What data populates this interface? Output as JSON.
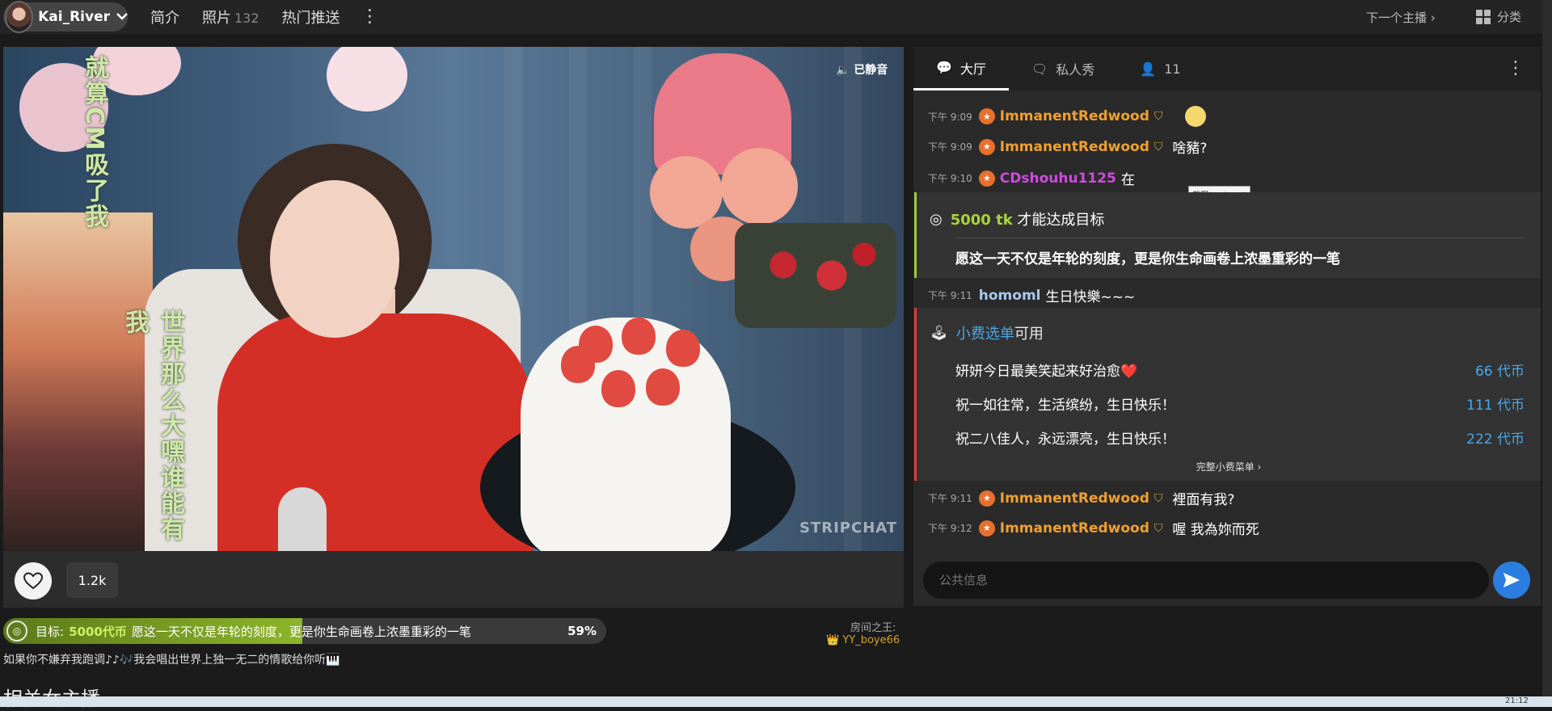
{
  "header": {
    "username": "Kai_River",
    "nav": [
      {
        "label": "简介",
        "count": ""
      },
      {
        "label": "照片",
        "count": "132"
      },
      {
        "label": "热门推送",
        "count": ""
      }
    ],
    "next_streamer": "下一个主播",
    "category": "分类"
  },
  "video": {
    "muted_label": "已静音",
    "overlay_text_1": "就算CM吸了我",
    "overlay_text_2": "世界那么大嘿谁能有我",
    "watermark": "STRIPCHAT",
    "likes": "1.2k"
  },
  "goal": {
    "label": "目标:",
    "amount": "5000代币",
    "description": "愿这一天不仅是年轮的刻度，更是你生命画卷上浓墨重彩的一笔",
    "percent_text": "59%",
    "progress": 0.496
  },
  "room_king": {
    "label": "房间之王:",
    "name": "YY_boye66"
  },
  "stream_description": "如果你不嫌弃我跑调♪♪🎶我会唱出世界上独一无二的情歌给你听🎹",
  "related_title": "相关女主播",
  "chat": {
    "tabs": [
      {
        "label": "大厅",
        "icon": "chat-bubble-icon"
      },
      {
        "label": "私人秀",
        "icon": "private-chat-icon"
      },
      {
        "label": "11",
        "icon": "user-icon"
      }
    ],
    "messages": [
      {
        "time": "下午 9:09",
        "user": "ImmanentRedwood",
        "text": "",
        "color": "#f0a030",
        "emoji": true
      },
      {
        "time": "下午 9:09",
        "user": "ImmanentRedwood",
        "text": "啥豬?",
        "color": "#f0a030",
        "emoji": false
      },
      {
        "time": "下午 9:10",
        "user": "CDshouhu1125",
        "text": "在",
        "color": "#d04ae0",
        "emoji": false
      },
      {
        "time": "下午 9:11",
        "user": "homoml",
        "text": "生日快樂~~~",
        "color": "#a8c8f0",
        "emoji": false
      },
      {
        "time": "下午 9:11",
        "user": "ImmanentRedwood",
        "text": "裡面有我?",
        "color": "#f0a030",
        "emoji": false
      },
      {
        "time": "下午 9:12",
        "user": "ImmanentRedwood",
        "text": "喔 我為妳而死",
        "color": "#f0a030",
        "emoji": false
      }
    ],
    "tooltip": "截图(Ctrl + A)",
    "goal_card": {
      "amount": "5000 tk",
      "suffix": "才能达成目标",
      "description": "愿这一天不仅是年轮的刻度，更是你生命画卷上浓墨重彩的一笔"
    },
    "tip_menu": {
      "title_link": "小费选单",
      "title_suffix": "可用",
      "items": [
        {
          "label": "妍妍今日最美笑起来好治愈❤️",
          "price": "66 代币"
        },
        {
          "label": "祝一如往常，生活缤纷，生日快乐！",
          "price": "111 代币"
        },
        {
          "label": "祝二八佳人，永远漂亮，生日快乐！",
          "price": "222 代币"
        }
      ],
      "more": "完整小费菜单 ›"
    },
    "input_placeholder": "公共信息"
  },
  "taskbar": {
    "clock": "21:12"
  },
  "colors": {
    "accent": "#2b7ee0",
    "goal": "#9ccc3a",
    "tip": "#e23a3a",
    "link": "#4aa8e8"
  }
}
